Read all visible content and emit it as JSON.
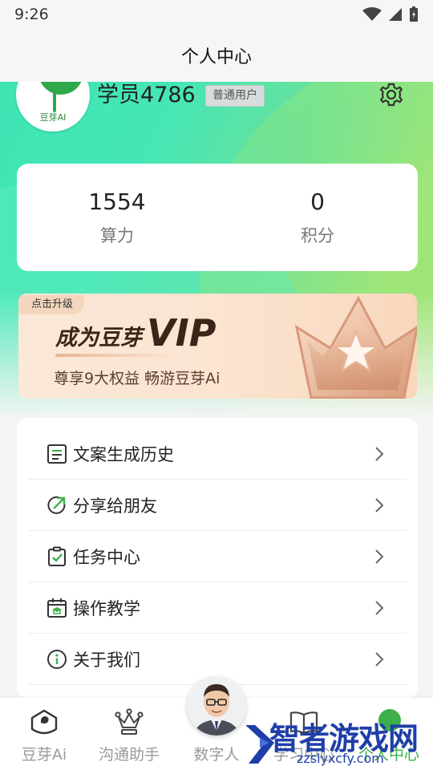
{
  "status_bar": {
    "time": "9:26"
  },
  "title_bar": {
    "title": "个人中心"
  },
  "profile": {
    "avatar_brand": "豆芽AI",
    "username": "学员4786",
    "badge": "普通用户",
    "settings_icon": "gear-icon"
  },
  "stats": [
    {
      "value": "1554",
      "label": "算力"
    },
    {
      "value": "0",
      "label": "积分"
    }
  ],
  "vip": {
    "tag": "点击升级",
    "title_cn": "成为豆芽",
    "title_en": "VIP",
    "subtitle": "尊享9大权益 畅游豆芽Ai"
  },
  "menu": [
    {
      "label": "文案生成历史",
      "icon": "document-list-icon"
    },
    {
      "label": "分享给朋友",
      "icon": "share-arrow-icon"
    },
    {
      "label": "任务中心",
      "icon": "clipboard-check-icon"
    },
    {
      "label": "操作教学",
      "icon": "calendar-graduation-icon"
    },
    {
      "label": "关于我们",
      "icon": "info-icon"
    }
  ],
  "tabs": [
    {
      "label": "豆芽Ai",
      "icon": "sprout-icon"
    },
    {
      "label": "沟通助手",
      "icon": "crown-icon"
    },
    {
      "label": "数字人",
      "icon": "digital-human-avatar"
    },
    {
      "label": "学习中心",
      "icon": "book-icon"
    },
    {
      "label": "个人中心",
      "icon": "user-icon"
    }
  ],
  "watermark": {
    "text": "智者游戏网",
    "url": "zzslyxcfy.com"
  },
  "colors": {
    "accent": "#3db04a",
    "hero_start": "#3ee5b3",
    "hero_end": "#a8e272",
    "vip_text": "#3b2418"
  }
}
